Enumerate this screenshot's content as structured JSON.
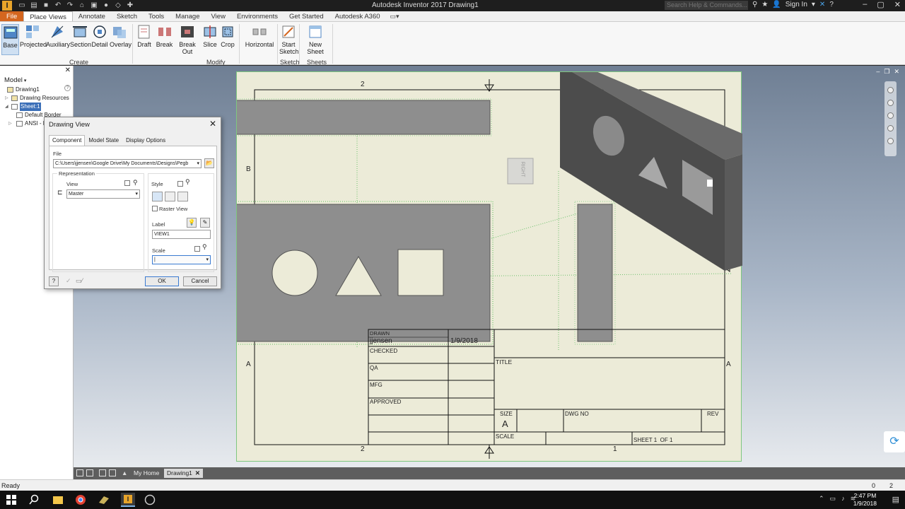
{
  "window": {
    "title": "Autodesk Inventor 2017   Drawing1",
    "search_placeholder": "Search Help & Commands...",
    "sign_in": "Sign In"
  },
  "ribbon_tabs": [
    "File",
    "Place Views",
    "Annotate",
    "Sketch",
    "Tools",
    "Manage",
    "View",
    "Environments",
    "Get Started",
    "Autodesk A360"
  ],
  "ribbon": {
    "buttons": {
      "base": "Base",
      "projected": "Projected",
      "auxiliary": "Auxiliary",
      "section": "Section",
      "detail": "Detail",
      "overlay": "Overlay",
      "draft": "Draft",
      "break": "Break",
      "break_out": "Break Out",
      "slice": "Slice",
      "crop": "Crop",
      "horizontal": "Horizontal",
      "start_sketch_1": "Start",
      "start_sketch_2": "Sketch",
      "new_sheet": "New Sheet"
    },
    "panels": {
      "create": "Create",
      "modify": "Modify",
      "sketch": "Sketch",
      "sheets": "Sheets"
    }
  },
  "browser": {
    "title": "Model",
    "items": [
      {
        "label": "Drawing1"
      },
      {
        "label": "Drawing Resources"
      },
      {
        "label": "Sheet:1"
      },
      {
        "label": "Default Border"
      },
      {
        "label": "ANSI - La"
      }
    ]
  },
  "dialog": {
    "title": "Drawing View",
    "tabs": [
      "Component",
      "Model State",
      "Display Options"
    ],
    "file_label": "File",
    "file_path": "C:\\Users\\jjensen\\Google Drive\\My Documents\\Designs\\Pegb",
    "representation_label": "Representation",
    "view_label": "View",
    "view_value": "Master",
    "style_label": "Style",
    "raster_view_label": "Raster View",
    "label_label": "Label",
    "label_value": "VIEW1",
    "scale_label": "Scale",
    "scale_value": "",
    "ok": "OK",
    "cancel": "Cancel"
  },
  "sheet": {
    "zone_top_left": "2",
    "zone_bottom_left": "2",
    "zone_bottom_right": "1",
    "zone_left_b": "B",
    "zone_left_a": "A",
    "zone_right_a": "A",
    "viewcube_face": "RIGHT"
  },
  "title_block": {
    "drawn_label": "DRAWN",
    "drawn_by": "jjensen",
    "drawn_date": "1/9/2018",
    "checked_label": "CHECKED",
    "qa_label": "QA",
    "mfg_label": "MFG",
    "approved_label": "APPROVED",
    "title_label": "TITLE",
    "size_label": "SIZE",
    "size_value": "A",
    "dwg_no_label": "DWG NO",
    "rev_label": "REV",
    "scale_label": "SCALE",
    "sheet_label": "SHEET 1  OF 1"
  },
  "doc_tabs": {
    "home": "My Home",
    "drawing": "Drawing1"
  },
  "status": {
    "text": "Ready",
    "count1": "0",
    "count2": "2"
  },
  "taskbar": {
    "time": "2:47 PM",
    "date": "1/9/2018"
  }
}
